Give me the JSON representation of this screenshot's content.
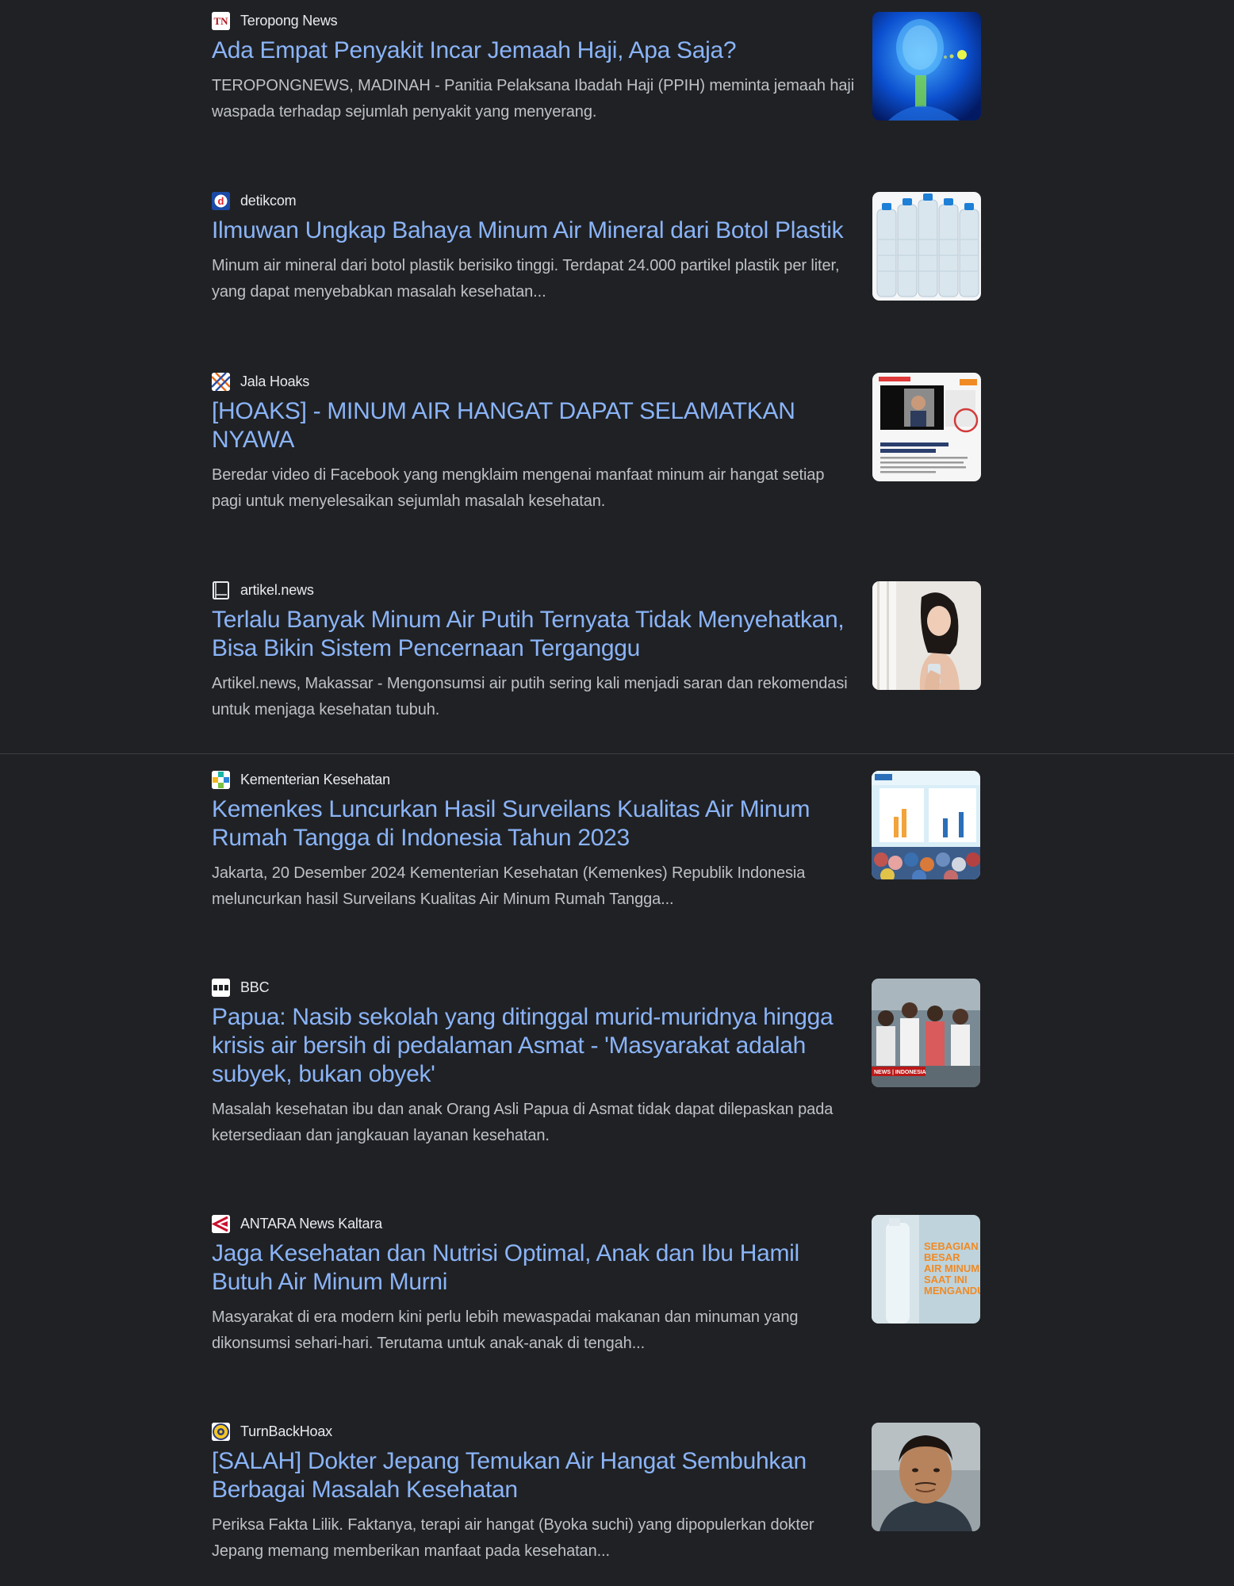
{
  "articles": [
    {
      "source": "Teropong News",
      "favicon_text": "TN",
      "title": "Ada Empat Penyakit Incar Jemaah Haji, Apa Saja?",
      "snippet": "TEROPONGNEWS, MADINAH - Panitia Pelaksana Ibadah Haji (PPIH) meminta jemaah haji waspada terhadap sejumlah penyakit yang menyerang."
    },
    {
      "source": "detikcom",
      "favicon_text": "d",
      "title": "Ilmuwan Ungkap Bahaya Minum Air Mineral dari Botol Plastik",
      "snippet": "Minum air mineral dari botol plastik berisiko tinggi. Terdapat 24.000 partikel plastik per liter, yang dapat menyebabkan masalah kesehatan..."
    },
    {
      "source": "Jala Hoaks",
      "title": "[HOAKS] - MINUM AIR HANGAT DAPAT SELAMATKAN NYAWA",
      "snippet": "Beredar video di Facebook yang mengklaim mengenai manfaat minum air hangat setiap pagi untuk menyelesaikan sejumlah masalah kesehatan."
    },
    {
      "source": "artikel.news",
      "title": "Terlalu Banyak Minum Air Putih Ternyata Tidak Menyehatkan, Bisa Bikin Sistem Pencernaan Terganggu",
      "snippet": "Artikel.news, Makassar - Mengonsumsi air putih sering kali menjadi saran dan rekomendasi untuk menjaga kesehatan tubuh."
    },
    {
      "source": "Kementerian Kesehatan",
      "title": "Kemenkes Luncurkan Hasil Surveilans Kualitas Air Minum Rumah Tangga di Indonesia Tahun 2023",
      "snippet": "Jakarta, 20 Desember 2024 Kementerian Kesehatan (Kemenkes) Republik Indonesia meluncurkan hasil Surveilans Kualitas Air Minum Rumah Tangga..."
    },
    {
      "source": "BBC",
      "title": "Papua: Nasib sekolah yang ditinggal murid-muridnya hingga krisis air bersih di pedalaman Asmat - 'Masyarakat adalah subyek, bukan obyek'",
      "snippet": "Masalah kesehatan ibu dan anak Orang Asli Papua di Asmat tidak dapat dilepaskan pada ketersediaan dan jangkauan layanan kesehatan.",
      "thumb_caption": "NEWS | INDONESIA"
    },
    {
      "source": "ANTARA News Kaltara",
      "title": "Jaga Kesehatan dan Nutrisi Optimal, Anak dan Ibu Hamil Butuh Air Minum Murni",
      "snippet": "Masyarakat di era modern kini perlu lebih mewaspadai makanan dan minuman yang dikonsumsi sehari-hari. Terutama untuk anak-anak di tengah...",
      "thumb_text": [
        "SEBAGIAN",
        "BESAR",
        "AIR MINUM",
        "SAAT INI",
        "MENGANDUN"
      ]
    },
    {
      "source": "TurnBackHoax",
      "title": "[SALAH] Dokter Jepang Temukan Air Hangat Sembuhkan Berbagai Masalah Kesehatan",
      "snippet": "Periksa Fakta Lilik. Faktanya, terapi air hangat (Byoka suchi) yang dipopulerkan dokter Jepang memang memberikan manfaat pada kesehatan..."
    }
  ],
  "colors": {
    "background": "#202124",
    "title_link": "#8ab4f8",
    "snippet_text": "#bdc1c6",
    "source_text": "#e8eaed",
    "divider": "#3c4043"
  },
  "icons": [
    "teropong-news-favicon-icon",
    "detikcom-favicon-icon",
    "jala-hoaks-favicon-icon",
    "book-icon",
    "kemenkes-favicon-icon",
    "bbc-favicon-icon",
    "antara-favicon-icon",
    "turnbackhoax-favicon-icon"
  ]
}
